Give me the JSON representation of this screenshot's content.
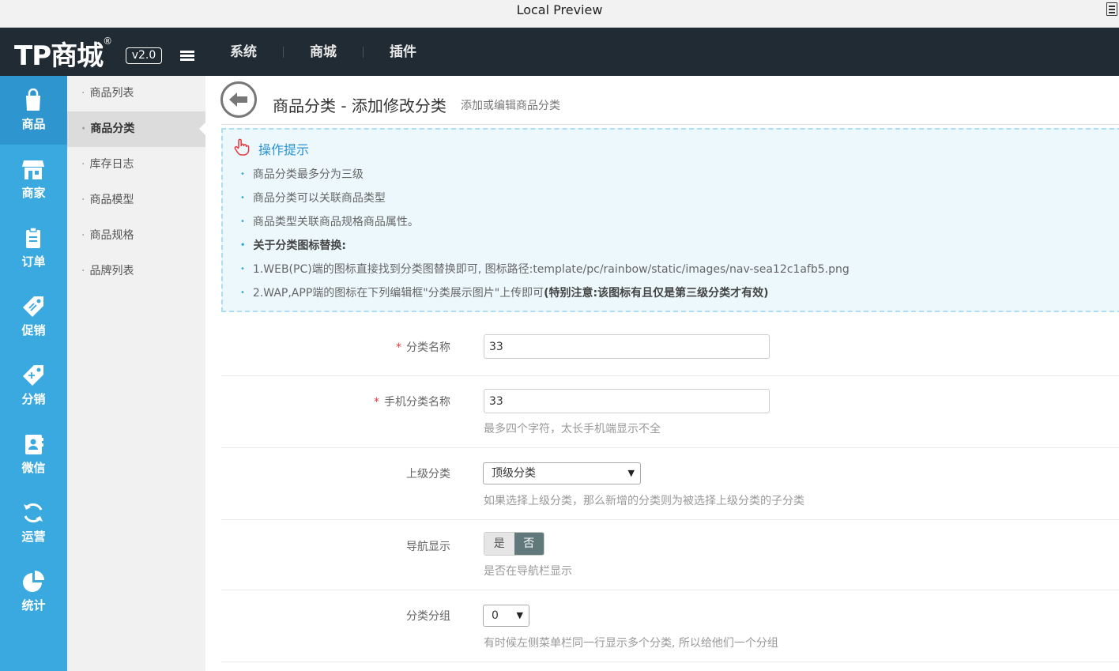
{
  "window": {
    "title": "Local Preview"
  },
  "brand": {
    "logo": "TP商城",
    "reg": "®",
    "version": "v2.0"
  },
  "top_nav": [
    "系统",
    "商城",
    "插件"
  ],
  "icon_sidebar": [
    {
      "label": "商品",
      "icon": "shopping-bag-icon",
      "active": true
    },
    {
      "label": "商家",
      "icon": "store-icon"
    },
    {
      "label": "订单",
      "icon": "order-icon"
    },
    {
      "label": "促销",
      "icon": "promotion-tag-icon"
    },
    {
      "label": "分销",
      "icon": "distribution-tag-icon"
    },
    {
      "label": "微信",
      "icon": "wechat-book-icon"
    },
    {
      "label": "运营",
      "icon": "refresh-icon"
    },
    {
      "label": "统计",
      "icon": "pie-chart-icon"
    }
  ],
  "sub_sidebar": [
    "商品列表",
    "商品分类",
    "库存日志",
    "商品模型",
    "商品规格",
    "品牌列表"
  ],
  "header": {
    "title": "商品分类 - 添加修改分类",
    "subtitle": "添加或编辑商品分类"
  },
  "tips": {
    "title": "操作提示",
    "lines": [
      "商品分类最多分为三级",
      "商品分类可以关联商品类型",
      "商品类型关联商品规格商品属性。",
      "关于分类图标替换:",
      "1.WEB(PC)端的图标直接找到分类图替换即可, 图标路径:template/pc/rainbow/static/images/nav-sea12c1afb5.png",
      "2.WAP,APP端的图标在下列编辑框\"分类展示图片\"上传即可",
      "(特别注意:该图标有且仅是第三级分类才有效)"
    ]
  },
  "form": {
    "name": {
      "label": "分类名称",
      "required": "*",
      "value": "33"
    },
    "mobile_name": {
      "label": "手机分类名称",
      "required": "*",
      "value": "33",
      "hint": "最多四个字符，太长手机端显示不全"
    },
    "parent": {
      "label": "上级分类",
      "value": "顶级分类",
      "hint": "如果选择上级分类，那么新增的分类则为被选择上级分类的子分类"
    },
    "nav_show": {
      "label": "导航显示",
      "yes": "是",
      "no": "否",
      "hint": "是否在导航栏显示"
    },
    "group": {
      "label": "分类分组",
      "value": "0",
      "hint": "有时候左侧菜单栏同一行显示多个分类, 所以给他们一个分组"
    }
  },
  "colors": {
    "sidebar": "#39a9e0",
    "topbar": "#212b33",
    "accent": "#2a93d1",
    "required": "#e4393c"
  }
}
